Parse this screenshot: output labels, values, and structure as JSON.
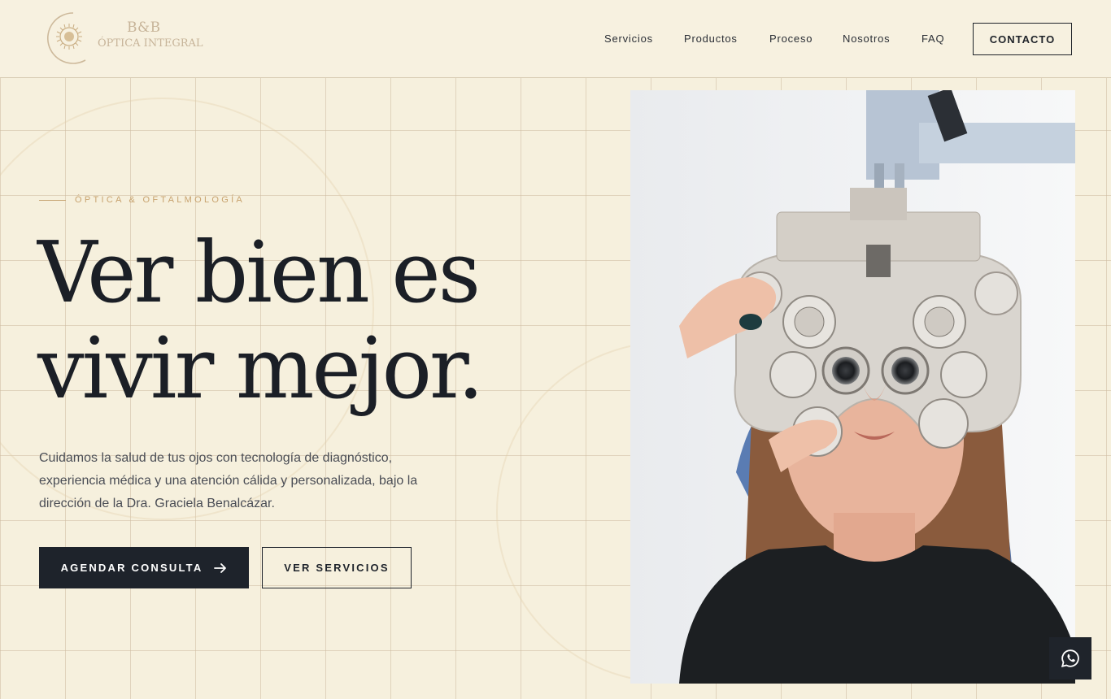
{
  "header": {
    "logo": {
      "line1": "B&B",
      "line2": "ÓPTICA INTEGRAL"
    },
    "nav": [
      "Servicios",
      "Productos",
      "Proceso",
      "Nosotros",
      "FAQ"
    ],
    "contact_label": "CONTACTO"
  },
  "hero": {
    "eyebrow": "ÓPTICA & OFTALMOLOGÍA",
    "headline_line1": "Ver bien es",
    "headline_line2": "vivir mejor.",
    "intro": "Cuidamos la salud de tus ojos con tecnología de diagnóstico, experiencia médica y una atención cálida y personalizada, bajo la dirección de la Dra. Graciela Benalcázar.",
    "primary_cta": "AGENDAR CONSULTA",
    "secondary_cta": "VER SERVICIOS"
  },
  "icons": {
    "cta_arrow": "arrow-right-icon",
    "floating": "whatsapp-icon",
    "logo": "sun-logo-icon"
  },
  "colors": {
    "background": "#f6f0dd",
    "dark": "#1e232b",
    "accent": "#c8a36f"
  }
}
